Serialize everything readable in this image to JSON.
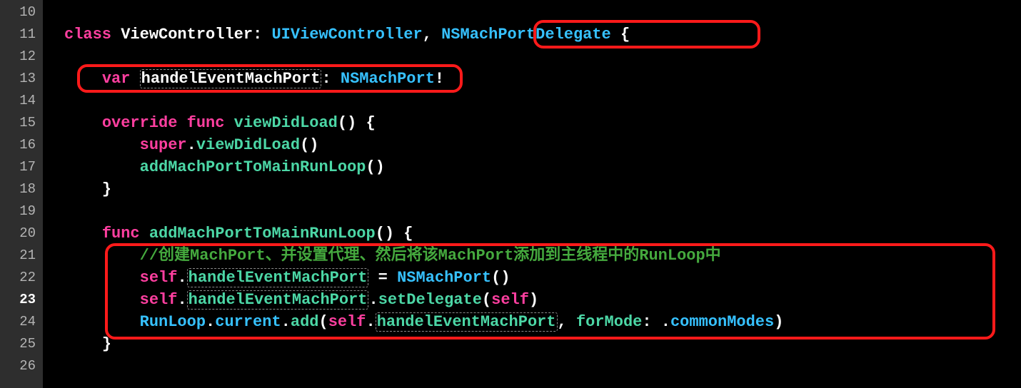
{
  "lines": {
    "l10": "10",
    "l11": "11",
    "l12": "12",
    "l13": "13",
    "l14": "14",
    "l15": "15",
    "l16": "16",
    "l17": "17",
    "l18": "18",
    "l19": "19",
    "l20": "20",
    "l21": "21",
    "l22": "22",
    "l23": "23",
    "l24": "24",
    "l25": "25",
    "l26": "26"
  },
  "code": {
    "class_kw": "class",
    "class_name": "ViewController",
    "colon": ":",
    "uiviewcontroller": "UIViewController",
    "comma": ",",
    "nsmachportdelegate": "NSMachPortDelegate",
    "lbrace": "{",
    "rbrace": "}",
    "var_kw": "var",
    "handel_prop": "handelEventMachPort",
    "nsmachport": "NSMachPort",
    "bang": "!",
    "override_kw": "override",
    "func_kw": "func",
    "viewdidload": "viewDidLoad",
    "parens": "()",
    "super_kw": "super",
    "dot": ".",
    "addmachport_call": "addMachPortToMainRunLoop",
    "addmachport_decl": "addMachPortToMainRunLoop",
    "comment1": "//创建MachPort、并设置代理、然后将该MachPort添加到主线程中的RunLoop中",
    "self_kw": "self",
    "eq": " = ",
    "setdelegate": "setDelegate",
    "lparen": "(",
    "rparen": ")",
    "runloop": "RunLoop",
    "current": "current",
    "add": "add",
    "formode": "forMode",
    "commonmodes": "commonModes",
    "commaSpace": ", "
  }
}
